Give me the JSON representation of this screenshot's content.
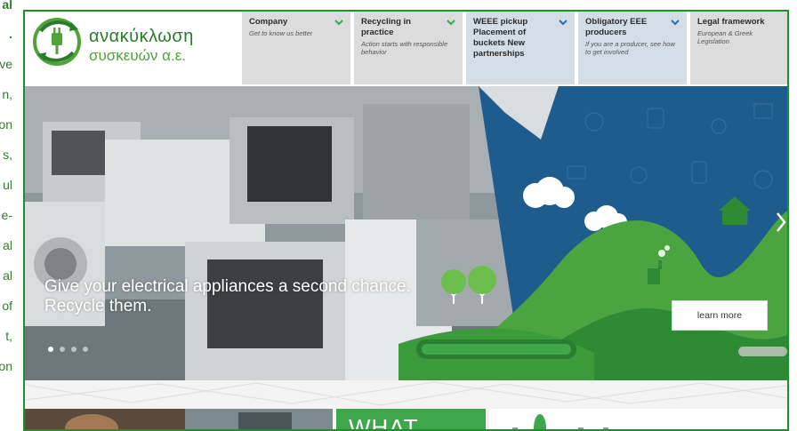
{
  "left_column": {
    "lines": [
      {
        "text": "al",
        "bold": true
      },
      {
        "text": ".",
        "bold": true
      },
      {
        "text": "ve",
        "bold": false
      },
      {
        "text": "n,",
        "bold": false
      },
      {
        "text": "on",
        "bold": false
      },
      {
        "text": "s,",
        "bold": false
      },
      {
        "text": "ul",
        "bold": false
      },
      {
        "text": "e-",
        "bold": false
      },
      {
        "text": "al",
        "bold": false
      },
      {
        "text": "al",
        "bold": false
      },
      {
        "text": "of",
        "bold": false
      },
      {
        "text": "t,",
        "bold": false
      },
      {
        "text": "on",
        "bold": false
      }
    ]
  },
  "logo": {
    "word1": "ανακύκλωση",
    "word2": "συσκευών α.ε."
  },
  "nav": [
    {
      "title": "Company",
      "subtitle": "Get to know us better",
      "chevron": "chevron-down-green"
    },
    {
      "title": "Recycling in practice",
      "subtitle": "Action starts with responsible behavior",
      "chevron": "chevron-down-green"
    },
    {
      "title": "WEEE pickup Placement of buckets New partnerships",
      "subtitle": "",
      "chevron": "chevron-down-blue"
    },
    {
      "title": "Obligatory EEE producers",
      "subtitle": "If you are a producer, see how to get involved",
      "chevron": "chevron-down-blue"
    },
    {
      "title": "Legal framework",
      "subtitle": "European & Greek Legislation",
      "chevron": ""
    }
  ],
  "hero": {
    "caption_line1": "Give your electrical appliances a second chance.",
    "caption_line2": "Recycle them.",
    "button_label": "learn more",
    "slides": 4,
    "active_slide": 1
  },
  "lower": {
    "what_label": "WHAT"
  },
  "colors": {
    "brand_green": "#3ea64b",
    "frame_green": "#1f8f2c",
    "nav_gray": "#dcdcdc",
    "nav_blue": "#d2dde6",
    "hero_blue": "#1e5c8e"
  }
}
